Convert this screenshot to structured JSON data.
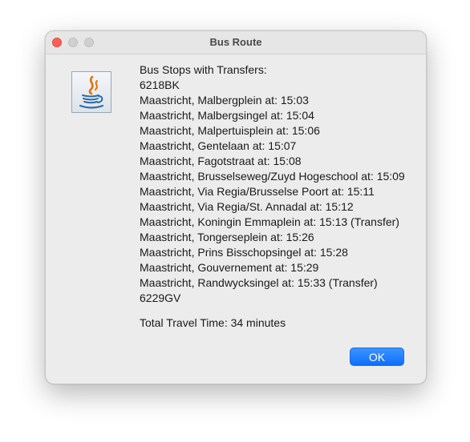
{
  "window": {
    "title": "Bus Route"
  },
  "message": {
    "header": "Bus Stops with Transfers:",
    "start_postcode": "6218BK",
    "stops": [
      "Maastricht, Malbergplein at: 15:03",
      "Maastricht, Malbergsingel at: 15:04",
      "Maastricht, Malpertuisplein at: 15:06",
      "Maastricht, Gentelaan at: 15:07",
      "Maastricht, Fagotstraat at: 15:08",
      "Maastricht, Brusselseweg/Zuyd Hogeschool at: 15:09",
      "Maastricht, Via Regia/Brusselse Poort at: 15:11",
      "Maastricht, Via Regia/St. Annadal at: 15:12",
      "Maastricht, Koningin Emmaplein at: 15:13 (Transfer)",
      "Maastricht, Tongerseplein at: 15:26",
      "Maastricht, Prins Bisschopsingel at: 15:28",
      "Maastricht, Gouvernement at: 15:29",
      "Maastricht, Randwycksingel at: 15:33 (Transfer)"
    ],
    "end_postcode": "6229GV",
    "total_time": "Total Travel Time: 34 minutes"
  },
  "buttons": {
    "ok_label": "OK"
  },
  "icons": {
    "app": "java-coffee-cup-icon"
  },
  "colors": {
    "accent": "#0e6dfb",
    "close": "#ff5f57",
    "java_red": "#e76f00",
    "java_blue": "#2e6aa5"
  }
}
